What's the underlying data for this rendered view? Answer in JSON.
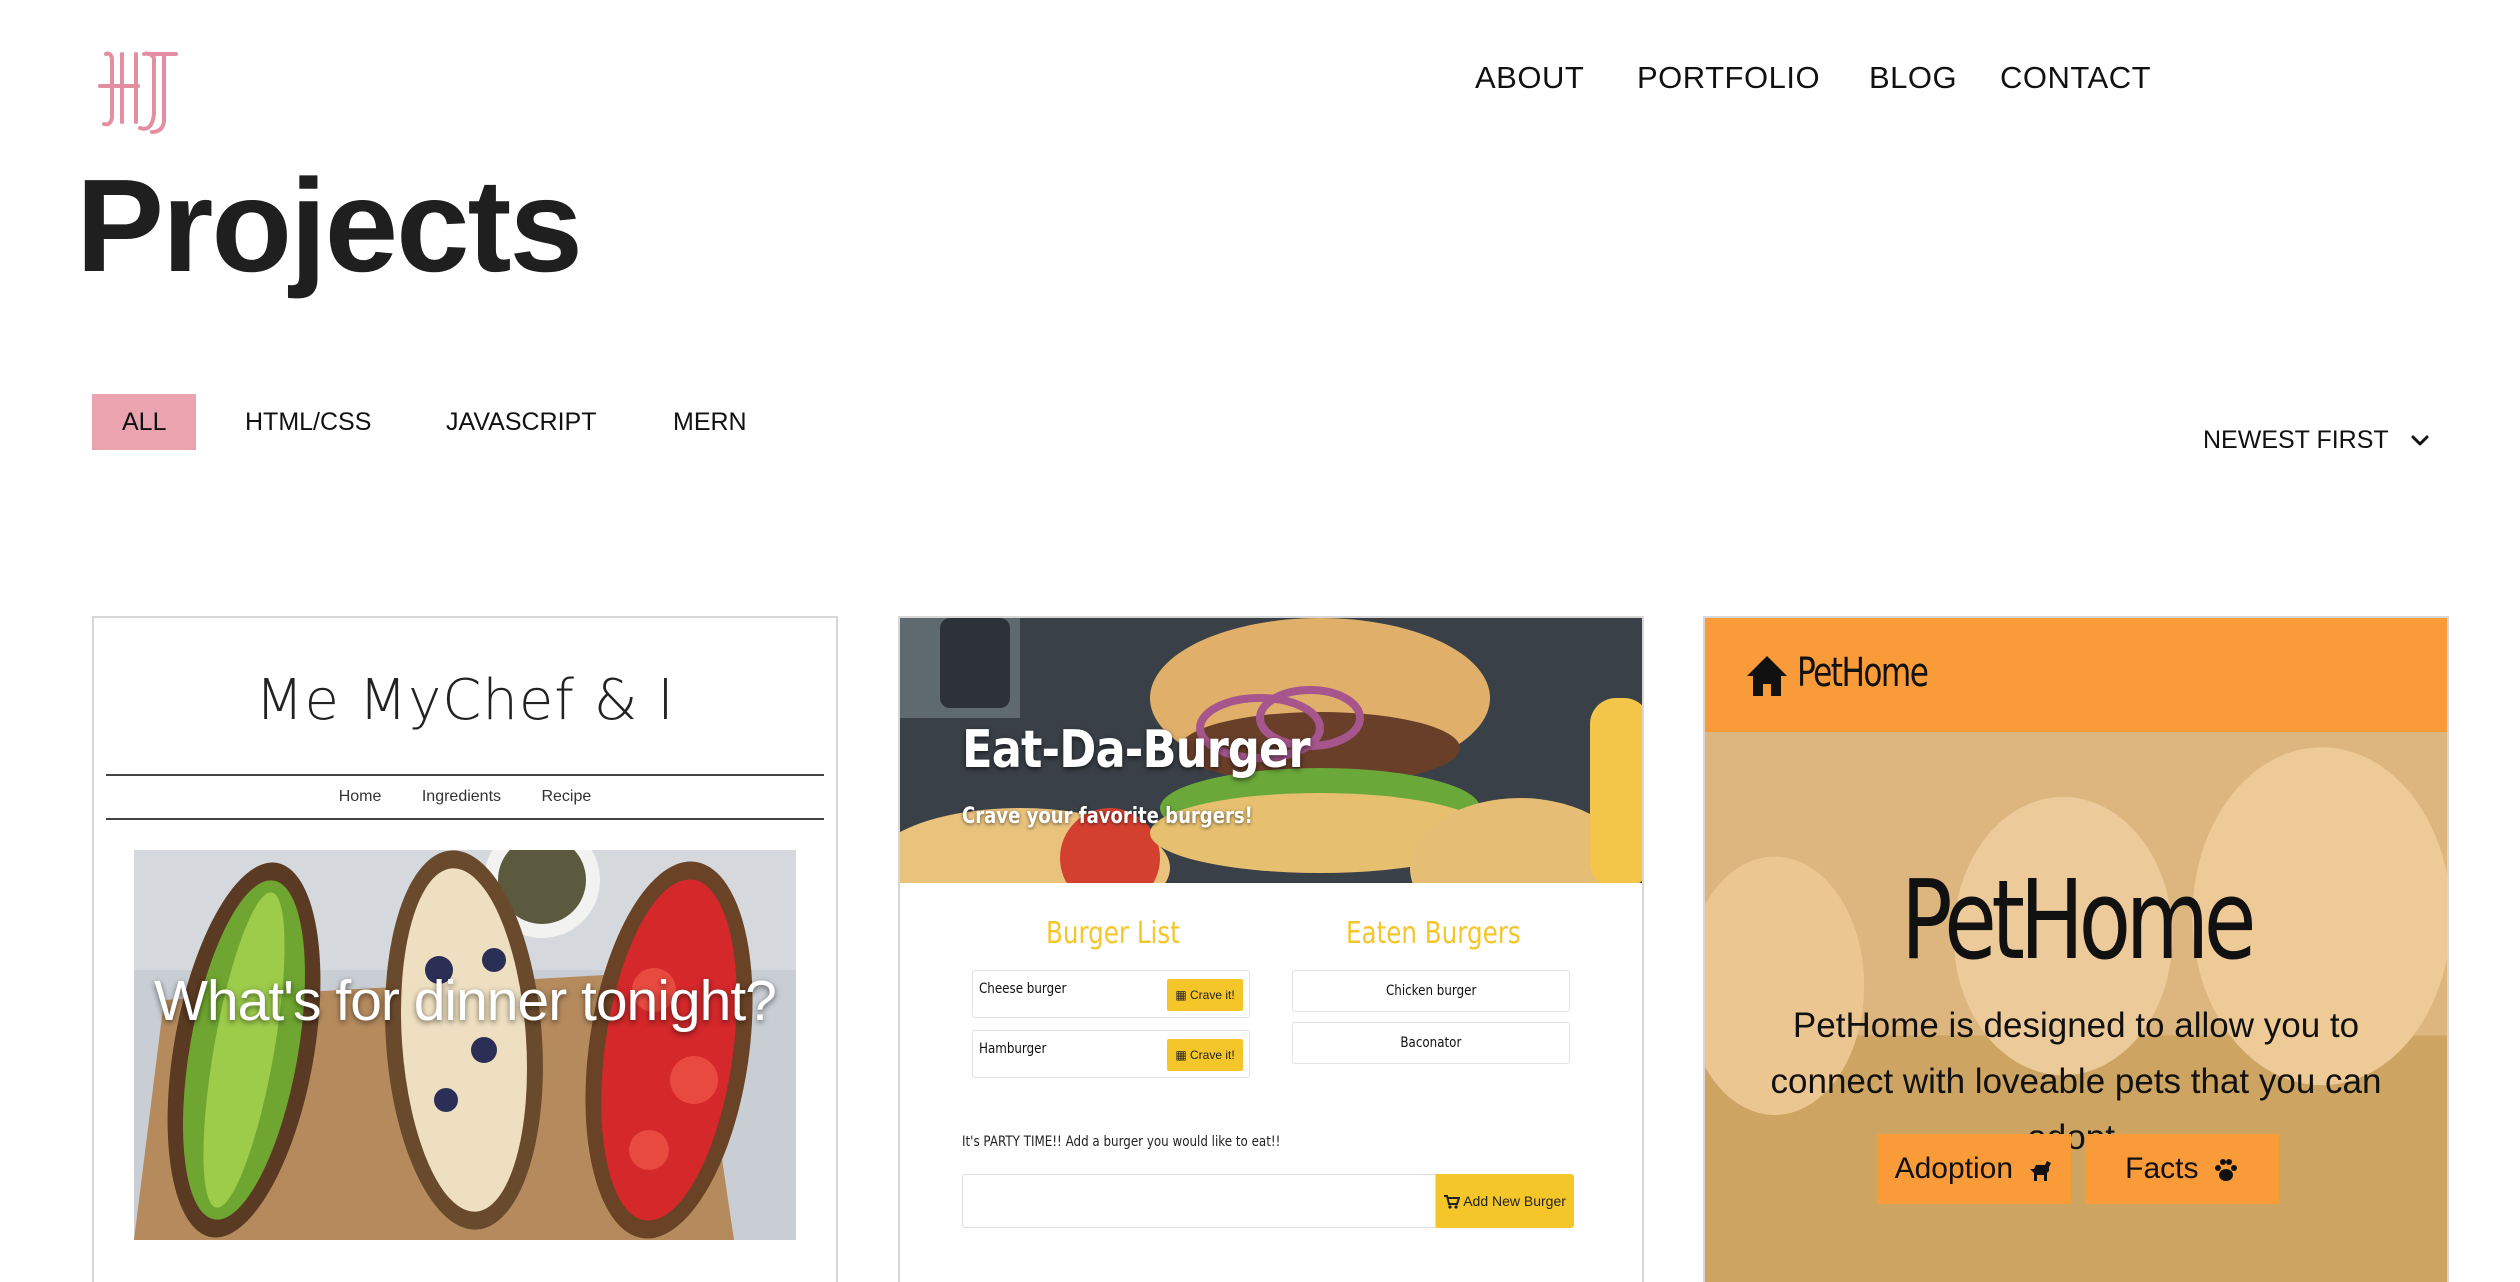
{
  "brand": {
    "logo_icon": "hj-monogram-logo",
    "accent": "#eba3b0"
  },
  "nav": {
    "about": "ABOUT",
    "portfolio": "PORTFOLIO",
    "blog": "BLOG",
    "contact": "CONTACT"
  },
  "page": {
    "title": "Projects"
  },
  "filters": {
    "all": "ALL",
    "html_css": "HTML/CSS",
    "javascript": "JAVASCRIPT",
    "mern": "MERN",
    "active": "ALL"
  },
  "sort": {
    "selected": "NEWEST FIRST",
    "icon": "chevron-down-icon"
  },
  "projects": {
    "mychef": {
      "title": "Me MyChef & I",
      "nav": [
        "Home",
        "Ingredients",
        "Recipe"
      ],
      "hero_text": "What's for dinner tonight?"
    },
    "burger": {
      "title": "Eat-Da-Burger",
      "subtitle": "Crave your favorite burgers!",
      "list_title": "Burger List",
      "eaten_title": "Eaten Burgers",
      "list": [
        {
          "name": "Cheese burger",
          "button": "Crave it!"
        },
        {
          "name": "Hamburger",
          "button": "Crave it!"
        }
      ],
      "eaten": [
        "Chicken burger",
        "Baconator"
      ],
      "party_text": "It's PARTY TIME!! Add a burger you would like to eat!!",
      "add_button": "Add New Burger",
      "accent": "#f5c62a"
    },
    "pethome": {
      "brand": "PetHome",
      "title": "PetHome",
      "description": "PetHome is designed to allow you to connect with loveable pets that you can adopt.",
      "adoption_button": "Adoption",
      "facts_button": "Facts",
      "accent": "#fa9b3a"
    }
  }
}
